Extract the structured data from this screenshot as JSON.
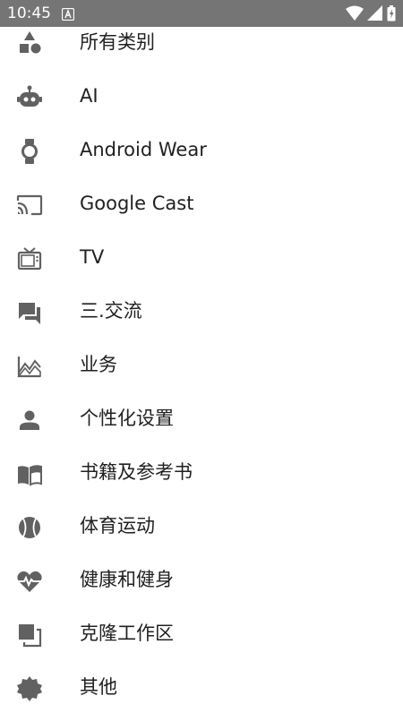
{
  "status_bar": {
    "time": "10:45",
    "icons": [
      "a-notification-icon",
      "wifi-icon",
      "cell-signal-icon",
      "battery-icon"
    ]
  },
  "colors": {
    "status_bar_bg": "#757575",
    "icon_color": "#616161",
    "text_color": "#212121",
    "background": "#ffffff"
  },
  "categories": {
    "items": [
      {
        "label": "所有类别",
        "icon": "all-categories-shapes-icon"
      },
      {
        "label": "AI",
        "icon": "robot-icon"
      },
      {
        "label": "Android Wear",
        "icon": "watch-icon"
      },
      {
        "label": "Google Cast",
        "icon": "cast-icon"
      },
      {
        "label": "TV",
        "icon": "tv-icon"
      },
      {
        "label": "三.交流",
        "icon": "chat-icon"
      },
      {
        "label": "业务",
        "icon": "business-chart-icon"
      },
      {
        "label": "个性化设置",
        "icon": "person-icon"
      },
      {
        "label": "书籍及参考书",
        "icon": "book-icon"
      },
      {
        "label": "体育运动",
        "icon": "sports-ball-icon"
      },
      {
        "label": "健康和健身",
        "icon": "heart-pulse-icon"
      },
      {
        "label": "克隆工作区",
        "icon": "clone-workspace-icon"
      },
      {
        "label": "其他",
        "icon": "gear-badge-icon"
      }
    ]
  }
}
